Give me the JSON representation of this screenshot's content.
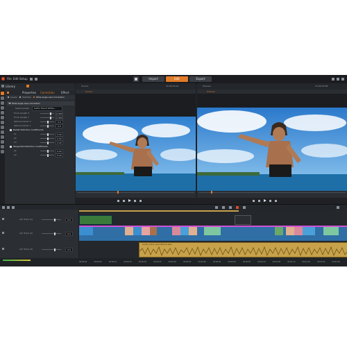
{
  "menu": {
    "items": [
      "File",
      "Edit",
      "Setup"
    ],
    "tabs": [
      "Import",
      "Edit",
      "Export"
    ],
    "active_tab": "Edit"
  },
  "left_panel": {
    "library_label": "Library",
    "tabs": [
      "Properties",
      "Correction",
      "Effect"
    ],
    "sub_tabs": [
      "Levels",
      "Stabilize",
      "Wide angle Lens Correction"
    ],
    "section_title": "Wide angle Lens Correction",
    "preset_label": "Select preset",
    "preset_value": "GoPro Hero3 White...",
    "params": [
      {
        "label": "Focal Length X",
        "value": "0.880"
      },
      {
        "label": "Focal Length Y",
        "value": "0.880"
      },
      {
        "label": "Optical Center X",
        "value": "0.0"
      },
      {
        "label": "Optical Center Y",
        "value": "0.0"
      }
    ],
    "radial_title": "Radial Distortion Coefficients",
    "radial": [
      {
        "label": "k1",
        "value": "0.00"
      },
      {
        "label": "k2",
        "value": "0.00"
      },
      {
        "label": "k3",
        "value": "0.00"
      }
    ],
    "tangential_title": "Tangential Distortion Coefficients",
    "tangential": [
      {
        "label": "p1",
        "value": "0.00"
      },
      {
        "label": "p2",
        "value": "0.00"
      }
    ]
  },
  "preview_left": {
    "title": "Source",
    "timecode": "15:00:16:14",
    "mode": "Source"
  },
  "preview_right": {
    "title": "Preview",
    "timecode": "15:00:25:08",
    "mode": "Preview"
  },
  "timeline": {
    "tracks": [
      {
        "name": "A/V Track (1)",
        "value": "0.0"
      },
      {
        "name": "A/V Track (2)",
        "value": "0.0"
      },
      {
        "name": "A/V Track (3)",
        "value": "0.0"
      }
    ],
    "audio_clip_label": "audio_track_soundtrack.wav",
    "ruler_ticks": [
      "00:00:00",
      "00:00:05",
      "00:00:10",
      "00:00:15",
      "00:00:20",
      "00:00:25",
      "00:00:30",
      "00:00:35",
      "00:00:40",
      "00:00:45",
      "00:00:50",
      "00:00:55",
      "00:01:00",
      "00:01:05",
      "00:01:10",
      "00:01:15",
      "00:01:20",
      "00:01:25"
    ]
  },
  "colors": {
    "accent_orange": "#e07b2a",
    "clip_blue": "#3b8fd0",
    "audio_gold": "#c8a24a",
    "edit_tab": "#e07b2a"
  }
}
